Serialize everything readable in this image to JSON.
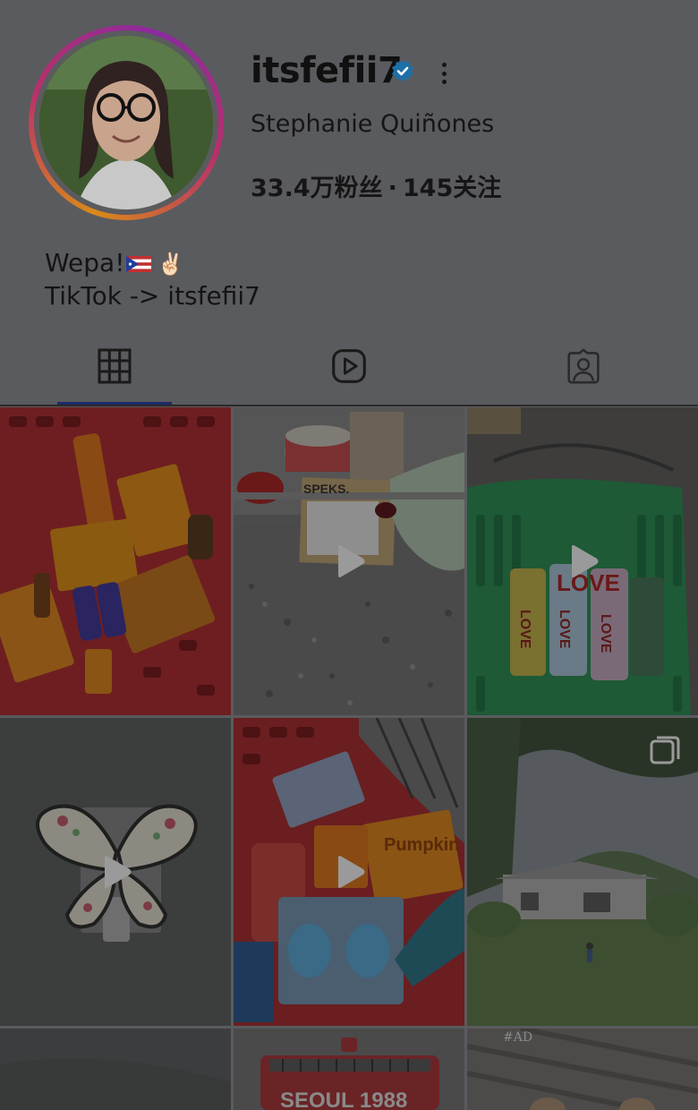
{
  "profile": {
    "username": "itsfefii7",
    "verified": true,
    "full_name": "Stephanie Quiñones",
    "followers": "33.4万粉丝",
    "separator": "·",
    "following": "145关注",
    "bio_line1": "Wepa!",
    "bio_line1_emoji": "✌🏻",
    "bio_line2": "TikTok -> itsfefii7"
  },
  "tabs": [
    {
      "name": "posts",
      "icon": "grid-icon",
      "active": true
    },
    {
      "name": "reels",
      "icon": "reels-icon",
      "active": false
    },
    {
      "name": "tagged",
      "icon": "tagged-person-icon",
      "active": false
    }
  ],
  "posts": [
    {
      "type": "photo",
      "desc": "red shopping basket with snacks"
    },
    {
      "type": "video",
      "overlay_text": "SPEKS."
    },
    {
      "type": "video",
      "overlay_text": "LOVE"
    },
    {
      "type": "video",
      "desc": "butterfly night light"
    },
    {
      "type": "video",
      "overlay_text": "Pumpkin"
    },
    {
      "type": "carousel",
      "desc": "house and lawn"
    },
    {
      "type": "photo"
    },
    {
      "type": "photo",
      "overlay_text": "SEOUL 1988"
    },
    {
      "type": "photo",
      "overlay_text": "#AD"
    }
  ],
  "colors": {
    "dim_overlay": "#5a5b5e",
    "verified_blue": "#1d6fa8",
    "active_tab_indicator": "#1d2a6a"
  }
}
